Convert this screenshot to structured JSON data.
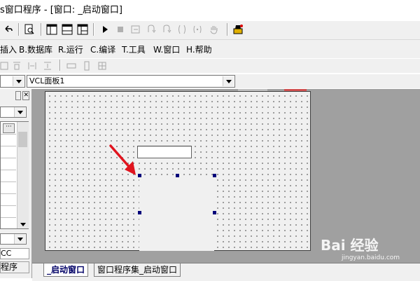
{
  "window": {
    "title_prefix": "s窗口程序",
    "title_rest": " - [窗口: _启动窗口]"
  },
  "toolbar": {
    "buttons": [
      "undo-icon",
      "find-icon",
      "layout1-icon",
      "layout2-icon",
      "layout3-icon",
      "run-icon",
      "stop-icon",
      "step-icon",
      "step-into-icon",
      "step-out-icon",
      "step-over-icon",
      "hand-icon",
      "debug-icon"
    ]
  },
  "menu": {
    "items": [
      {
        "label": "插入"
      },
      {
        "label": "B.数据库"
      },
      {
        "label": "R.运行"
      },
      {
        "label": "C.编译"
      },
      {
        "label": "T.工具"
      },
      {
        "label": "W.窗口"
      },
      {
        "label": "H.帮助"
      }
    ]
  },
  "combo": {
    "left_value": "",
    "right_value": "VCL面板1"
  },
  "left_panel": {
    "item1": "CC",
    "item2": "程序",
    "value_button": "···"
  },
  "tabs": {
    "active": "_启动窗口",
    "inactive": "窗口程序集_启动窗口"
  },
  "watermark": {
    "text": "Bai 经验",
    "sub": "jingyan.baidu.com"
  },
  "colors": {
    "workspace": "#a0a0a0",
    "form_bg": "#f0f0f0",
    "handle": "#00007a",
    "arrow": "#e0141e"
  }
}
